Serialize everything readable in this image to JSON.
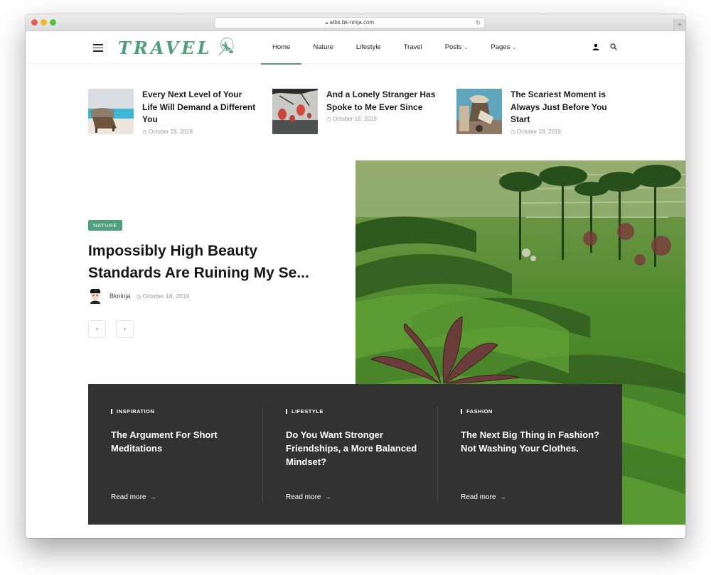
{
  "browser": {
    "url": "atbs.bk-ninja.com",
    "lock_icon": "lock-icon",
    "reload_icon": "reload-icon",
    "new_tab_label": "+"
  },
  "header": {
    "logo_text": "TRAVEL",
    "brand_color": "#4f9e7c",
    "nav": [
      {
        "label": "Home",
        "active": true
      },
      {
        "label": "Nature"
      },
      {
        "label": "Lifestyle"
      },
      {
        "label": "Travel"
      },
      {
        "label": "Posts",
        "has_dropdown": true
      },
      {
        "label": "Pages",
        "has_dropdown": true
      }
    ],
    "chevron": "⌄",
    "icons": [
      "menu-icon",
      "user-icon",
      "search-icon"
    ]
  },
  "mini_posts": [
    {
      "title": "Every Next Level of Your Life Will Demand a Different You",
      "date": "October 18, 2019"
    },
    {
      "title": "And a Lonely Stranger Has Spoke to Me Ever Since",
      "date": "October 18, 2019"
    },
    {
      "title": "The Scariest Moment is Always Just Before You Start",
      "date": "October 18, 2019"
    }
  ],
  "feature": {
    "category": "NATURE",
    "title": "Impossibly High Beauty Standards Are Ruining My Se...",
    "author": "Bkninja",
    "date": "October 18, 2019",
    "prev_label": "‹",
    "next_label": "›"
  },
  "dark_posts": [
    {
      "category": "INSPIRATION",
      "title": "The Argument For Short Meditations",
      "read_more": "Read more"
    },
    {
      "category": "LIFESTYLE",
      "title": "Do You Want Stronger Friendships, a More Balanced Mindset?",
      "read_more": "Read more"
    },
    {
      "category": "FASHION",
      "title": "The Next Big Thing in Fashion? Not Washing Your Clothes.",
      "read_more": "Read more"
    }
  ],
  "glyphs": {
    "clock": "◷",
    "arrow_right": "→"
  }
}
